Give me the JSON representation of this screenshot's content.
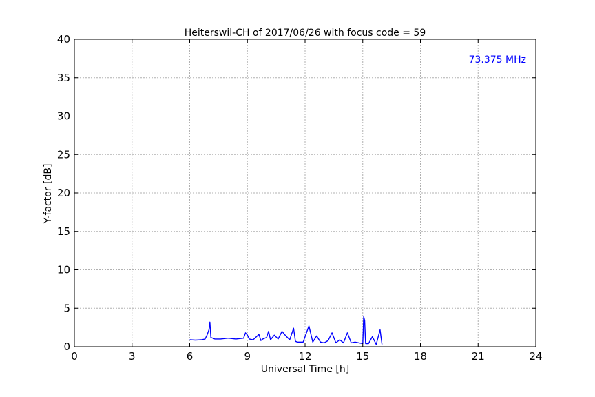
{
  "chart_data": {
    "type": "line",
    "title": "Heiterswil-CH of 2017/06/26 with focus code = 59",
    "xlabel": "Universal Time [h]",
    "ylabel": "Y-factor [dB]",
    "annotation": "73.375 MHz",
    "xlim": [
      0,
      24
    ],
    "ylim": [
      0,
      40
    ],
    "xticks": [
      0,
      3,
      6,
      9,
      12,
      15,
      18,
      21,
      24
    ],
    "yticks": [
      0,
      5,
      10,
      15,
      20,
      25,
      30,
      35,
      40
    ],
    "grid": true,
    "colors": {
      "series": "#0000ff",
      "annotation": "#0000ff",
      "grid": "#b0b0b0"
    },
    "series": [
      {
        "x": [
          6.0,
          6.3,
          6.6,
          6.8,
          6.9,
          7.0,
          7.05,
          7.1,
          7.3,
          7.6,
          8.0,
          8.4,
          8.8,
          8.9,
          9.0,
          9.1,
          9.3,
          9.6,
          9.7,
          9.8,
          10.0,
          10.1,
          10.2,
          10.4,
          10.6,
          10.8,
          11.0,
          11.2,
          11.4,
          11.5,
          11.6,
          11.9,
          12.2,
          12.4,
          12.6,
          12.8,
          13.0,
          13.2,
          13.4,
          13.6,
          13.8,
          14.0,
          14.2,
          14.4,
          14.6,
          14.8,
          15.0,
          15.05,
          15.1,
          15.15,
          15.3,
          15.5,
          15.7,
          15.9,
          16.0
        ],
        "values": [
          0.9,
          0.85,
          0.9,
          1.0,
          1.5,
          2.2,
          3.2,
          1.2,
          1.0,
          1.0,
          1.1,
          1.0,
          1.1,
          1.8,
          1.5,
          1.0,
          0.9,
          1.6,
          0.8,
          1.0,
          1.2,
          2.0,
          0.9,
          1.5,
          1.0,
          2.0,
          1.4,
          0.9,
          2.4,
          0.7,
          0.6,
          0.6,
          2.7,
          0.6,
          1.4,
          0.6,
          0.5,
          0.8,
          1.8,
          0.5,
          0.9,
          0.5,
          1.8,
          0.5,
          0.6,
          0.5,
          0.4,
          3.9,
          3.4,
          0.4,
          0.4,
          1.3,
          0.3,
          2.2,
          0.3
        ]
      }
    ]
  }
}
